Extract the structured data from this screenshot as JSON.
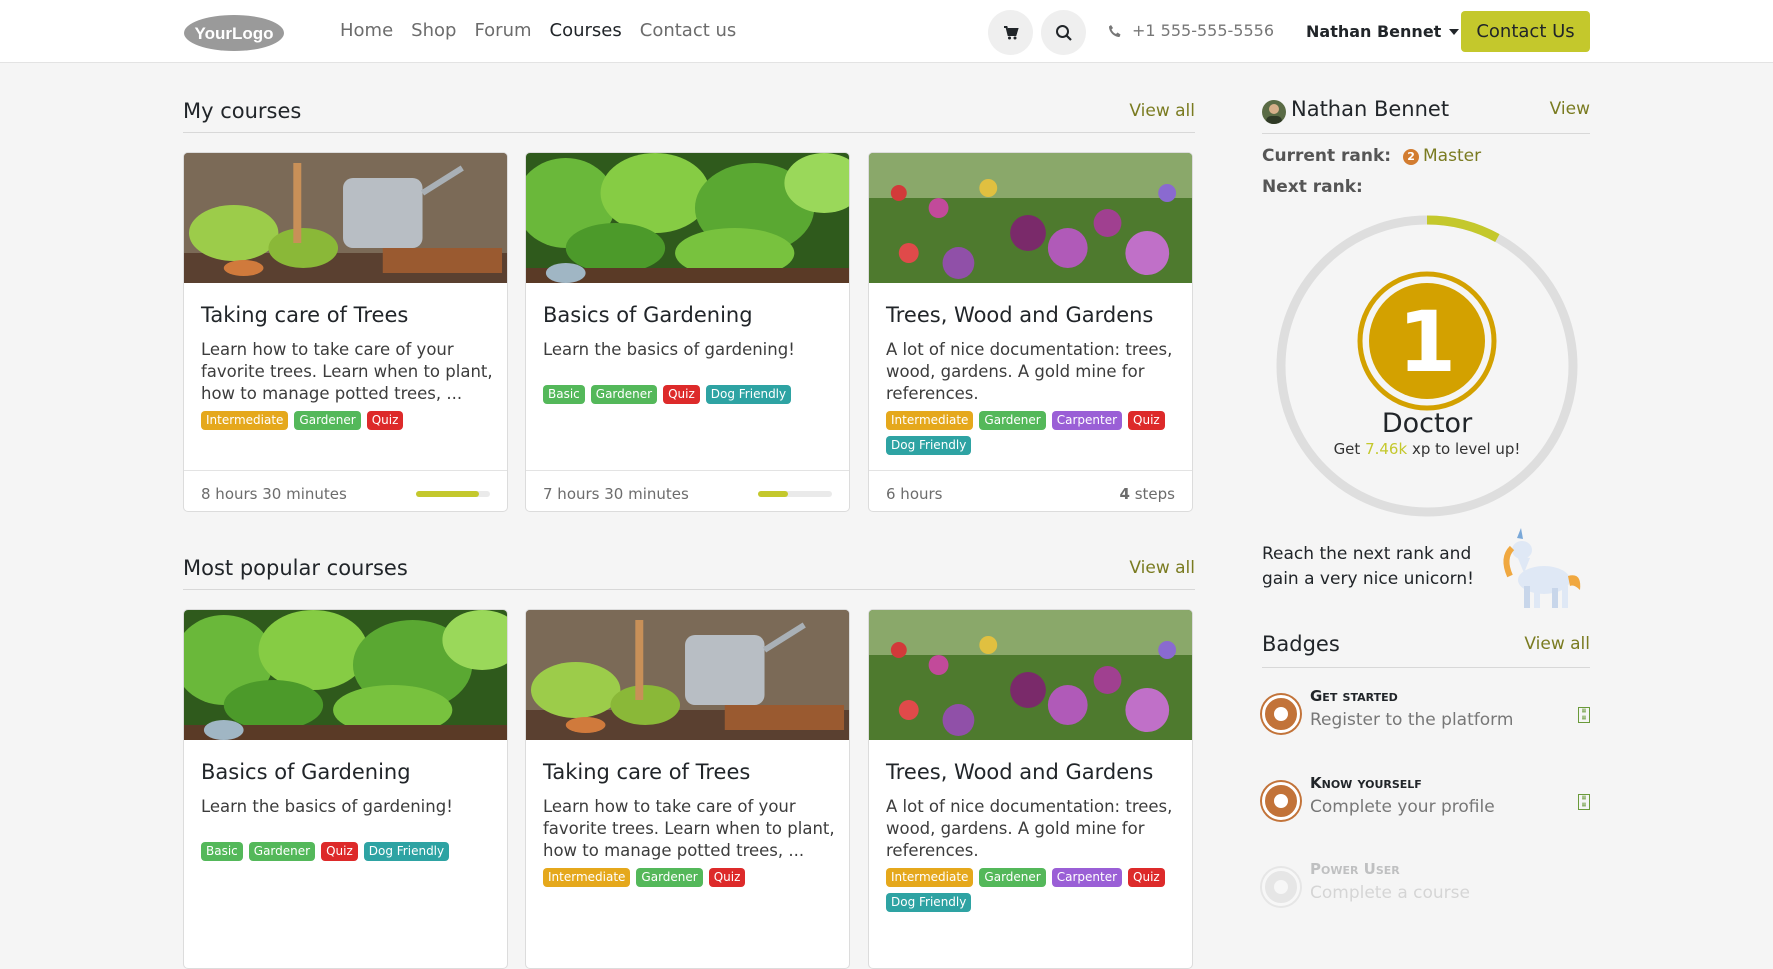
{
  "header": {
    "logo_text": "YourLogo",
    "nav": [
      "Home",
      "Shop",
      "Forum",
      "Courses",
      "Contact us"
    ],
    "active_nav": "Courses",
    "phone": "+1 555-555-5556",
    "user_name": "Nathan Bennet",
    "cta_label": "Contact Us"
  },
  "my_courses": {
    "title": "My courses",
    "view_all": "View all",
    "cards": [
      {
        "title": "Taking care of Trees",
        "desc": "Learn how to take care of your favorite trees. Learn when to plant, how to manage potted trees, ...",
        "tags": [
          "Intermediate",
          "Gardener",
          "Quiz"
        ],
        "duration": "8 hours 30 minutes",
        "progress": 0.85
      },
      {
        "title": "Basics of Gardening",
        "desc": "Learn the basics of gardening!",
        "tags": [
          "Basic",
          "Gardener",
          "Quiz",
          "Dog Friendly"
        ],
        "duration": "7 hours 30 minutes",
        "progress": 0.4
      },
      {
        "title": "Trees, Wood and Gardens",
        "desc": "A lot of nice documentation: trees, wood, gardens. A gold mine for references.",
        "tags": [
          "Intermediate",
          "Gardener",
          "Carpenter",
          "Quiz",
          "Dog Friendly"
        ],
        "duration": "6 hours",
        "steps_count": "4",
        "steps_label": "steps"
      }
    ]
  },
  "popular_courses": {
    "title": "Most popular courses",
    "view_all": "View all",
    "cards": [
      {
        "title": "Basics of Gardening",
        "desc": "Learn the basics of gardening!",
        "tags": [
          "Basic",
          "Gardener",
          "Quiz",
          "Dog Friendly"
        ]
      },
      {
        "title": "Taking care of Trees",
        "desc": "Learn how to take care of your favorite trees. Learn when to plant, how to manage potted trees, ...",
        "tags": [
          "Intermediate",
          "Gardener",
          "Quiz"
        ]
      },
      {
        "title": "Trees, Wood and Gardens",
        "desc": "A lot of nice documentation: trees, wood, gardens. A gold mine for references.",
        "tags": [
          "Intermediate",
          "Gardener",
          "Carpenter",
          "Quiz",
          "Dog Friendly"
        ]
      }
    ]
  },
  "tag_colors": {
    "Intermediate": "#e5a81c",
    "Basic": "#54b85a",
    "Gardener": "#54b85a",
    "Quiz": "#dd2a2a",
    "Dog Friendly": "#2ea3a3",
    "Carpenter": "#9a5fd6"
  },
  "profile": {
    "name": "Nathan Bennet",
    "view_label": "View",
    "current_rank_label": "Current rank:",
    "current_rank_badge": "2",
    "current_rank": "Master",
    "next_rank_label": "Next rank:",
    "rank_number": "1",
    "rank_name": "Doctor",
    "xp_prefix": "Get",
    "xp_value": "7.46k",
    "xp_suffix": "xp to level up!",
    "progress": 0.08,
    "unicorn_text": "Reach the next rank and gain a very nice unicorn!"
  },
  "badges": {
    "title": "Badges",
    "view_all": "View all",
    "items": [
      {
        "name": "Get started",
        "desc": "Register to the platform",
        "earned": true
      },
      {
        "name": "Know yourself",
        "desc": "Complete your profile",
        "earned": true
      },
      {
        "name": "Power User",
        "desc": "Complete a course",
        "earned": false
      }
    ]
  },
  "colors": {
    "accent": "#c4c82c",
    "link": "#7a7b20",
    "rank_gold": "#d3a100"
  }
}
